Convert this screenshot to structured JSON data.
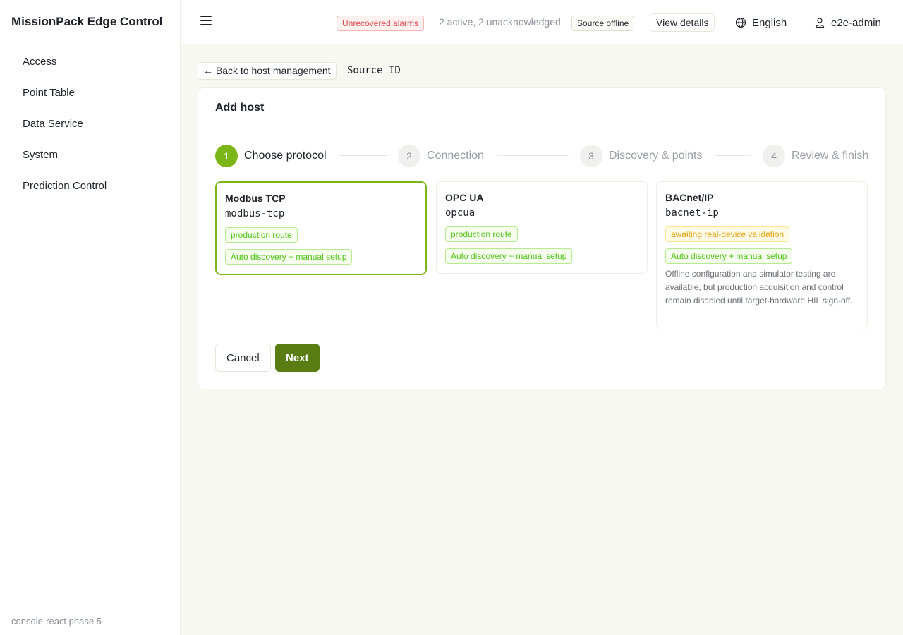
{
  "app": {
    "title": "MissionPack Edge Control"
  },
  "sidebar": {
    "items": [
      {
        "label": "Access"
      },
      {
        "label": "Point Table"
      },
      {
        "label": "Data Service"
      },
      {
        "label": "System"
      },
      {
        "label": "Prediction Control"
      }
    ],
    "footer": "console-react phase 5"
  },
  "header": {
    "menu_icon": "hamburger-menu-icon",
    "alarm_tag": "Unrecovered alarms",
    "alarm_summary": "2 active, 2 unacknowledged",
    "source_status": "Source offline",
    "view_details": "View details",
    "language": "English",
    "language_icon": "globe-icon",
    "user": "e2e-admin",
    "user_icon": "user-icon"
  },
  "page": {
    "back_label": "← Back to host management",
    "source_id_label": "Source ID",
    "card_title": "Add host"
  },
  "steps": [
    {
      "number": "1",
      "label": "Choose protocol",
      "active": true
    },
    {
      "number": "2",
      "label": "Connection",
      "active": false
    },
    {
      "number": "3",
      "label": "Discovery & points",
      "active": false
    },
    {
      "number": "4",
      "label": "Review & finish",
      "active": false
    }
  ],
  "protocols": [
    {
      "name": "Modbus TCP",
      "code": "modbus-tcp",
      "route_tag": "production route",
      "mode_tag": "Auto discovery + manual setup",
      "selected": true
    },
    {
      "name": "OPC UA",
      "code": "opcua",
      "route_tag": "production route",
      "mode_tag": "Auto discovery + manual setup",
      "selected": false
    },
    {
      "name": "BACnet/IP",
      "code": "bacnet-ip",
      "route_tag": "awaiting real-device validation",
      "mode_tag": "Auto discovery + manual setup",
      "note": "Offline configuration and simulator testing are available, but production acquisition and control remain disabled until target-hardware HIL sign-off.",
      "selected": false
    }
  ],
  "actions": {
    "cancel": "Cancel",
    "next": "Next"
  },
  "colors": {
    "accent": "#7cb518",
    "primary_button": "#5a7d13",
    "alarm": "#e5484d",
    "warning": "#e5a00d",
    "success": "#52c41a"
  }
}
